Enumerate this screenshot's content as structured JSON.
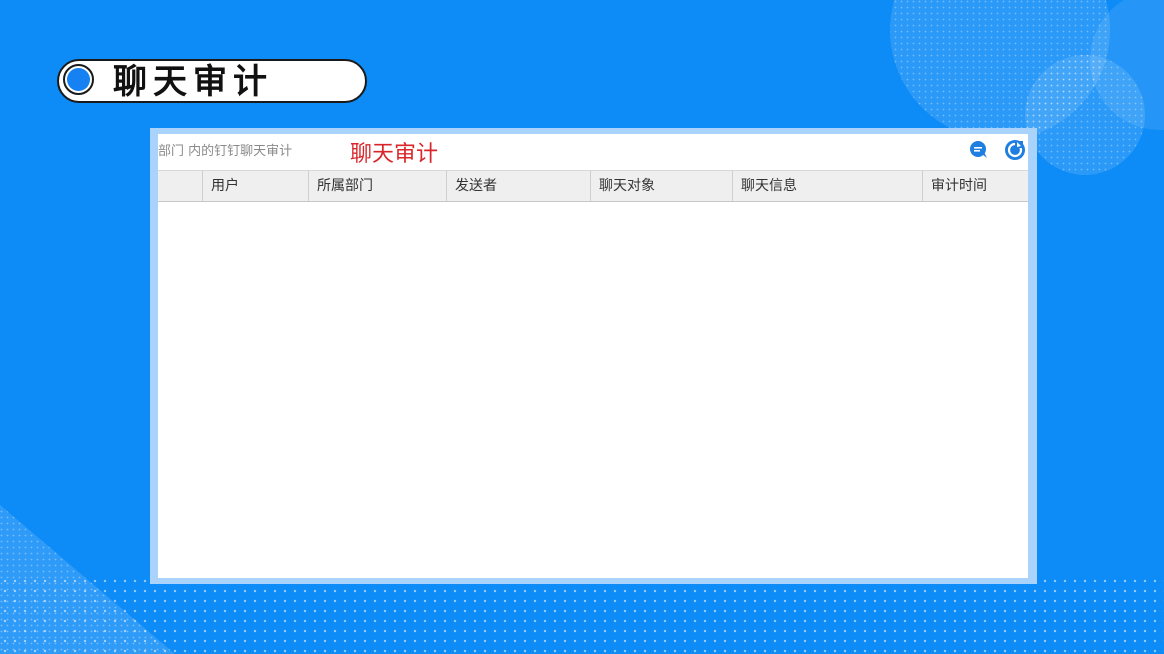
{
  "slide": {
    "title": "聊天审计"
  },
  "window": {
    "breadcrumb": "部门 内的钉钉聊天审计",
    "overlay_label": "聊天审计",
    "icons": {
      "chat": "chat-bubble-icon",
      "refresh": "refresh-icon"
    },
    "columns": [
      "用户",
      "所属部门",
      "发送者",
      "聊天对象",
      "聊天信息",
      "审计时间"
    ],
    "rows": []
  },
  "colors": {
    "background": "#0d8bf7",
    "accent_blue": "#1581f2",
    "overlay_red": "#d9262b",
    "frame": "#a9d3fb"
  }
}
